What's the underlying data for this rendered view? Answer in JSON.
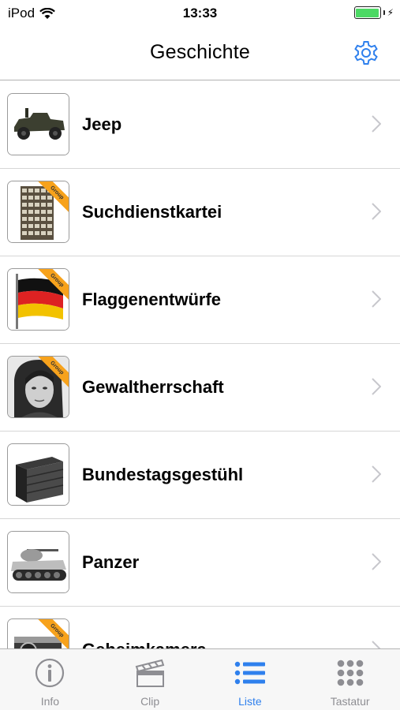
{
  "status_bar": {
    "carrier": "iPod",
    "time": "13:33"
  },
  "nav": {
    "title": "Geschichte",
    "settings_icon": "gear-icon"
  },
  "list": {
    "items": [
      {
        "label": "Jeep",
        "badge": ""
      },
      {
        "label": "Suchdienstkartei",
        "badge": "Group"
      },
      {
        "label": "Flaggenentwürfe",
        "badge": "Group"
      },
      {
        "label": "Gewaltherrschaft",
        "badge": "Group"
      },
      {
        "label": "Bundestagsgestühl",
        "badge": ""
      },
      {
        "label": "Panzer",
        "badge": ""
      },
      {
        "label": "Geheimkamera",
        "badge": "Group"
      }
    ]
  },
  "tab_bar": {
    "tabs": [
      {
        "label": "Info",
        "icon": "info-icon",
        "active": false
      },
      {
        "label": "Clip",
        "icon": "clapperboard-icon",
        "active": false
      },
      {
        "label": "Liste",
        "icon": "list-icon",
        "active": true
      },
      {
        "label": "Tastatur",
        "icon": "keypad-icon",
        "active": false
      }
    ]
  },
  "colors": {
    "accent": "#2f80ed",
    "inactive": "#8e8e93",
    "battery": "#4cd964",
    "badge": "#f7a21c"
  }
}
